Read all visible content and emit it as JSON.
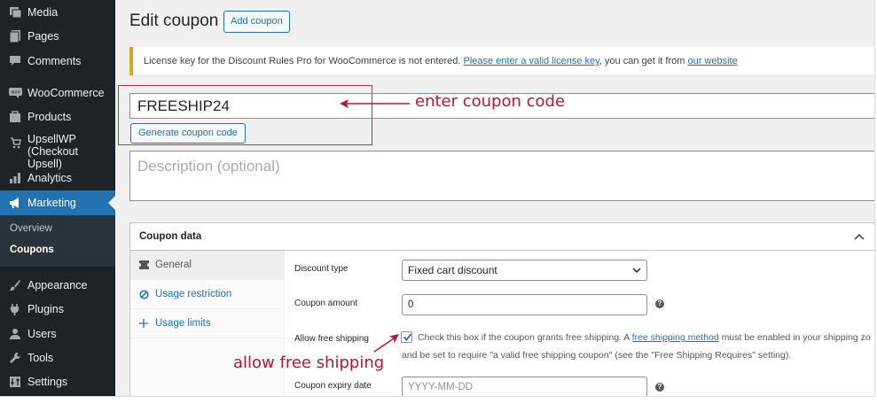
{
  "sidebar": {
    "items": [
      {
        "label": "Media",
        "icon": "media-icon"
      },
      {
        "label": "Pages",
        "icon": "pages-icon"
      },
      {
        "label": "Comments",
        "icon": "comments-icon"
      },
      {
        "label": "WooCommerce",
        "icon": "woocommerce-icon"
      },
      {
        "label": "Products",
        "icon": "products-icon"
      },
      {
        "label": "UpsellWP",
        "label2": "(Checkout Upsell)",
        "icon": "upsell-icon"
      },
      {
        "label": "Analytics",
        "icon": "analytics-icon"
      },
      {
        "label": "Marketing",
        "icon": "megaphone-icon",
        "active": true
      },
      {
        "label": "Appearance",
        "icon": "brush-icon"
      },
      {
        "label": "Plugins",
        "icon": "plugin-icon"
      },
      {
        "label": "Users",
        "icon": "user-icon"
      },
      {
        "label": "Tools",
        "icon": "wrench-icon"
      },
      {
        "label": "Settings",
        "icon": "settings-icon"
      }
    ],
    "submenu": [
      {
        "label": "Overview"
      },
      {
        "label": "Coupons",
        "current": true
      }
    ]
  },
  "header": {
    "title": "Edit coupon",
    "add_button": "Add coupon"
  },
  "notice": {
    "text1": "License key for the Discount Rules Pro for WooCommerce is not entered. ",
    "link1": "Please enter a valid license key",
    "text2": ", you can get it from ",
    "link2": "our website"
  },
  "coupon": {
    "code_value": "FREESHIP24",
    "generate_button": "Generate coupon code",
    "description_placeholder": "Description (optional)"
  },
  "annotations": {
    "enter_code": "enter coupon code",
    "free_shipping": "allow free shipping",
    "color": "#b5173a"
  },
  "panel": {
    "title": "Coupon data",
    "tabs": [
      {
        "label": "General",
        "icon": "ticket-icon"
      },
      {
        "label": "Usage restriction",
        "icon": "ban-icon"
      },
      {
        "label": "Usage limits",
        "icon": "plus-icon"
      }
    ],
    "fields": {
      "discount_type_label": "Discount type",
      "discount_type_value": "Fixed cart discount",
      "amount_label": "Coupon amount",
      "amount_value": "0",
      "free_shipping_label": "Allow free shipping",
      "free_shipping_checked": true,
      "free_shipping_text1": "Check this box if the coupon grants free shipping. A ",
      "free_shipping_link": "free shipping method",
      "free_shipping_text2": " must be enabled in your shipping zo",
      "free_shipping_text3": "and be set to require \"a valid free shipping coupon\" (see the \"Free Shipping Requires\" setting).",
      "expiry_label": "Coupon expiry date",
      "expiry_placeholder": "YYYY-MM-DD"
    }
  },
  "colors": {
    "sidebar_bg": "#1d2327",
    "accent": "#2271b1",
    "notice_border": "#dba617"
  }
}
